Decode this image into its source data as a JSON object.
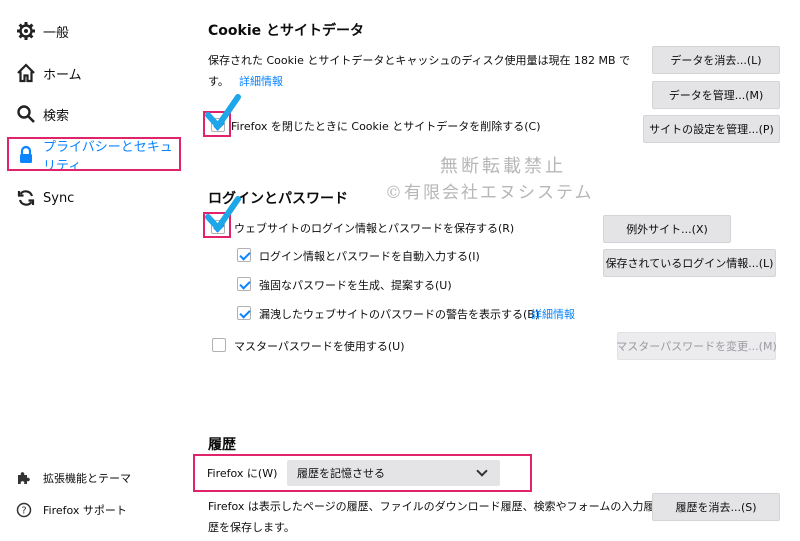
{
  "sidebar": {
    "items": [
      {
        "label": "一般",
        "icon": "gear-icon"
      },
      {
        "label": "ホーム",
        "icon": "home-icon"
      },
      {
        "label": "検索",
        "icon": "search-icon"
      },
      {
        "label": "プライバシーとセキュリティ",
        "icon": "lock-icon",
        "active": true
      },
      {
        "label": "Sync",
        "icon": "sync-icon"
      }
    ],
    "footer": [
      {
        "label": "拡張機能とテーマ",
        "icon": "puzzle-icon"
      },
      {
        "label": "Firefox サポート",
        "icon": "help-icon"
      }
    ]
  },
  "cookies": {
    "heading": "Cookie とサイトデータ",
    "desc_line1": "保存された Cookie とサイトデータとキャッシュのディスク使用量は現在 182 MB で",
    "desc_line2": "す。",
    "details_link": "詳細情報",
    "clear_button": "データを消去...(L)",
    "manage_button": "データを管理...(M)",
    "exceptions_button": "サイトの設定を管理...(P)",
    "delete_on_close_label": "Firefox を閉じたときに Cookie とサイトデータを削除する(C)",
    "delete_on_close_checked": true
  },
  "logins": {
    "heading": "ログインとパスワード",
    "save_label": "ウェブサイトのログイン情報とパスワードを保存する(R)",
    "save_checked": true,
    "autofill_label": "ログイン情報とパスワードを自動入力する(I)",
    "autofill_checked": true,
    "generate_label": "強固なパスワードを生成、提案する(U)",
    "generate_checked": true,
    "breach_label": "漏洩したウェブサイトのパスワードの警告を表示する(B)",
    "breach_checked": true,
    "breach_link": "詳細情報",
    "master_label": "マスターパスワードを使用する(U)",
    "master_checked": false,
    "exceptions_button": "例外サイト...(X)",
    "saved_logins_button": "保存されているログイン情報...(L)",
    "change_master_button": "マスターパスワードを変更...(M)"
  },
  "history": {
    "heading": "履歴",
    "firefox_will_label": "Firefox に(W)",
    "mode_value": "履歴を記憶させる",
    "desc_line1": "Firefox は表示したページの履歴、ファイルのダウンロード履歴、検索やフォームの入力履",
    "desc_line2": "歴を保存します。",
    "clear_button": "履歴を消去...(S)"
  },
  "watermark": {
    "line1": "無断転載禁止",
    "line2": "©有限会社エヌシステム"
  },
  "colors": {
    "accent": "#0a84ff",
    "annotation": "#e0236a",
    "big_check": "#1ea7e8"
  }
}
